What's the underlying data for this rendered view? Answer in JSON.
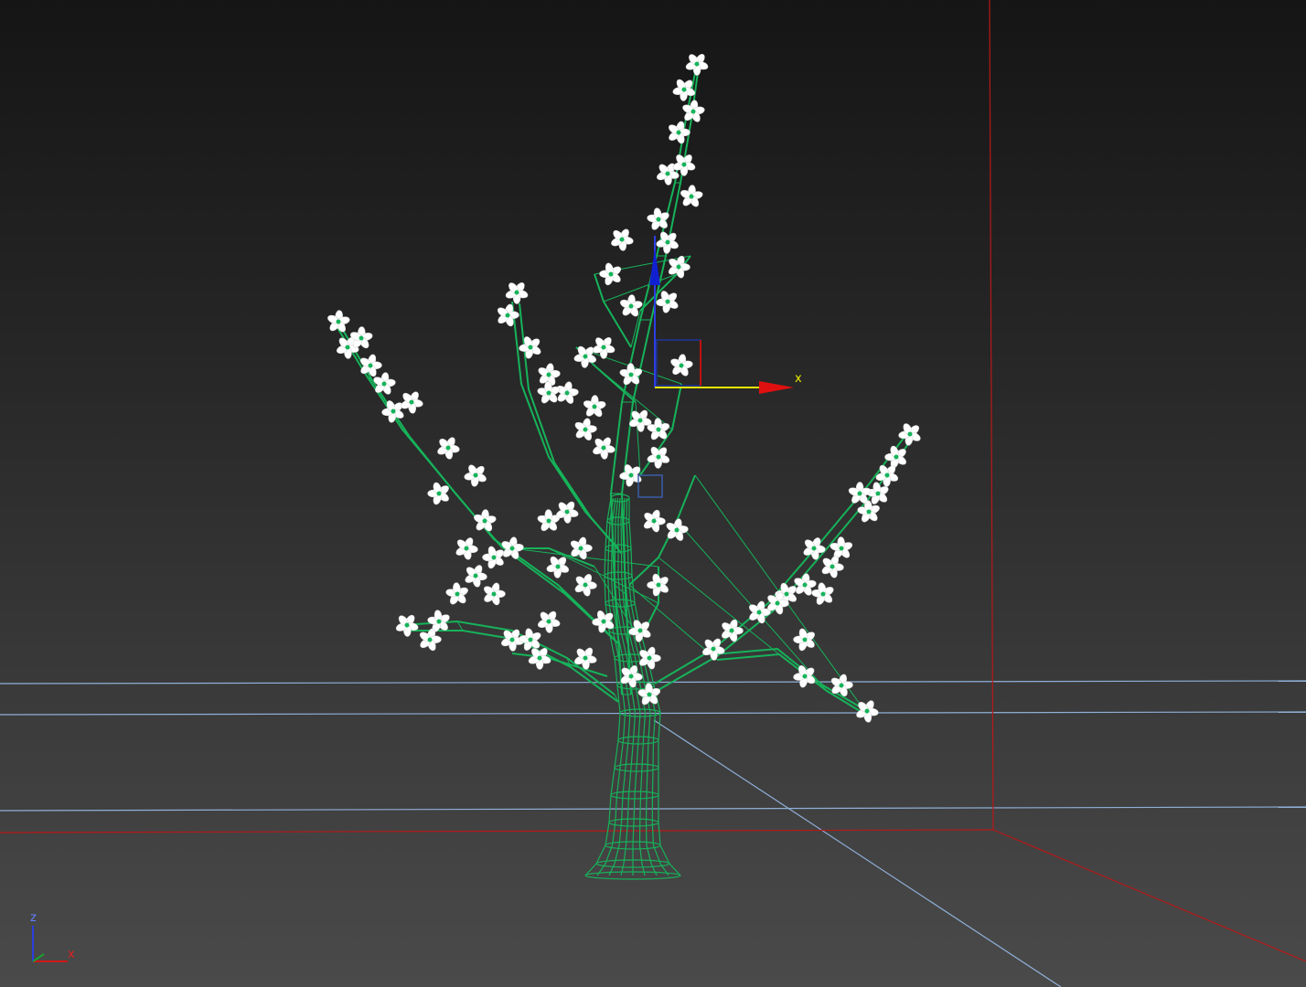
{
  "viewport": {
    "gizmo": {
      "x_label": "x"
    },
    "world_axis": {
      "z_label": "z",
      "x_label": "x"
    }
  },
  "colors": {
    "wire": "#16b35a",
    "blossom": "#ffffff",
    "grid_blue": "#8fb0d8",
    "grid_red": "#b81818",
    "gizmo_x": "#e01010",
    "gizmo_x_shaft": "#e8e800",
    "gizmo_z": "#1020d0",
    "gizmo_box": "#203080"
  },
  "icons": [
    "transform-gizmo-icon",
    "world-axis-icon"
  ]
}
